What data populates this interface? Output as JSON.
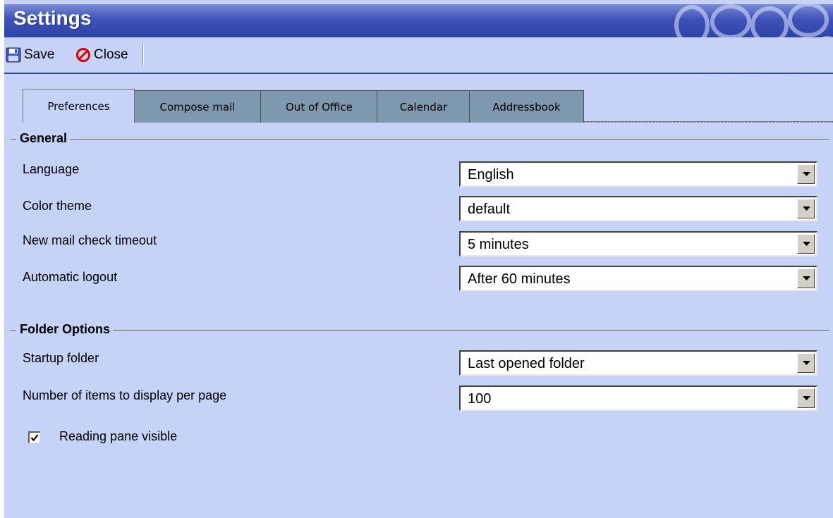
{
  "window": {
    "title": "Settings"
  },
  "toolbar": {
    "save_label": "Save",
    "close_label": "Close"
  },
  "tabs": [
    {
      "label": "Preferences",
      "active": true
    },
    {
      "label": "Compose mail",
      "active": false
    },
    {
      "label": "Out of Office",
      "active": false
    },
    {
      "label": "Calendar",
      "active": false
    },
    {
      "label": "Addressbook",
      "active": false
    }
  ],
  "general": {
    "heading": "General",
    "language": {
      "label": "Language",
      "value": "English"
    },
    "color_theme": {
      "label": "Color theme",
      "value": "default"
    },
    "mail_check": {
      "label": "New mail check timeout",
      "value": "5 minutes"
    },
    "auto_logout": {
      "label": "Automatic logout",
      "value": "After 60 minutes"
    }
  },
  "folder_options": {
    "heading": "Folder Options",
    "startup_folder": {
      "label": "Startup folder",
      "value": "Last opened folder"
    },
    "items_per_page": {
      "label": "Number of items to display per page",
      "value": "100"
    },
    "reading_pane": {
      "label": "Reading pane visible",
      "checked": true
    }
  },
  "icons": {
    "save": "floppy-disk-icon",
    "close": "no-entry-icon",
    "dropdown": "chevron-down-icon",
    "check": "checkmark-icon"
  },
  "colors": {
    "title_bar": "#3f52b8",
    "panel_background": "#c6d3f7",
    "inactive_tab": "#7e98ae",
    "close_icon": "#e00000"
  }
}
